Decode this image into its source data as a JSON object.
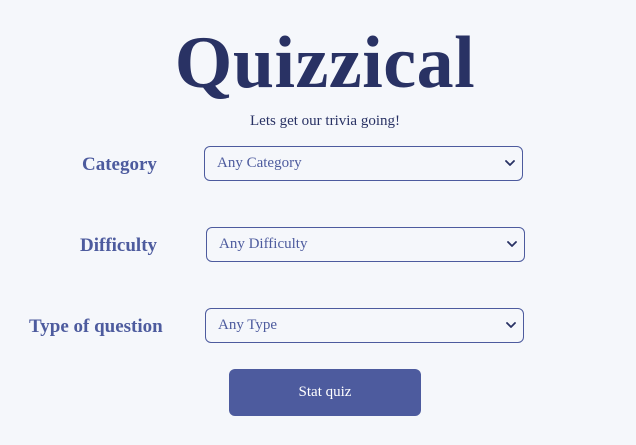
{
  "header": {
    "title": "Quizzical",
    "subtitle": "Lets get our trivia going!"
  },
  "form": {
    "category": {
      "label": "Category",
      "selected": "Any Category"
    },
    "difficulty": {
      "label": "Difficulty",
      "selected": "Any Difficulty"
    },
    "type": {
      "label": "Type of question",
      "selected": "Any Type"
    },
    "start_label": "Stat quiz"
  },
  "icons": {
    "select_chevron": "chevron-down-icon"
  },
  "colors": {
    "background": "#F5F7FB",
    "title": "#293264",
    "accent": "#4D5B9E",
    "button_text": "#FFFFFF"
  }
}
